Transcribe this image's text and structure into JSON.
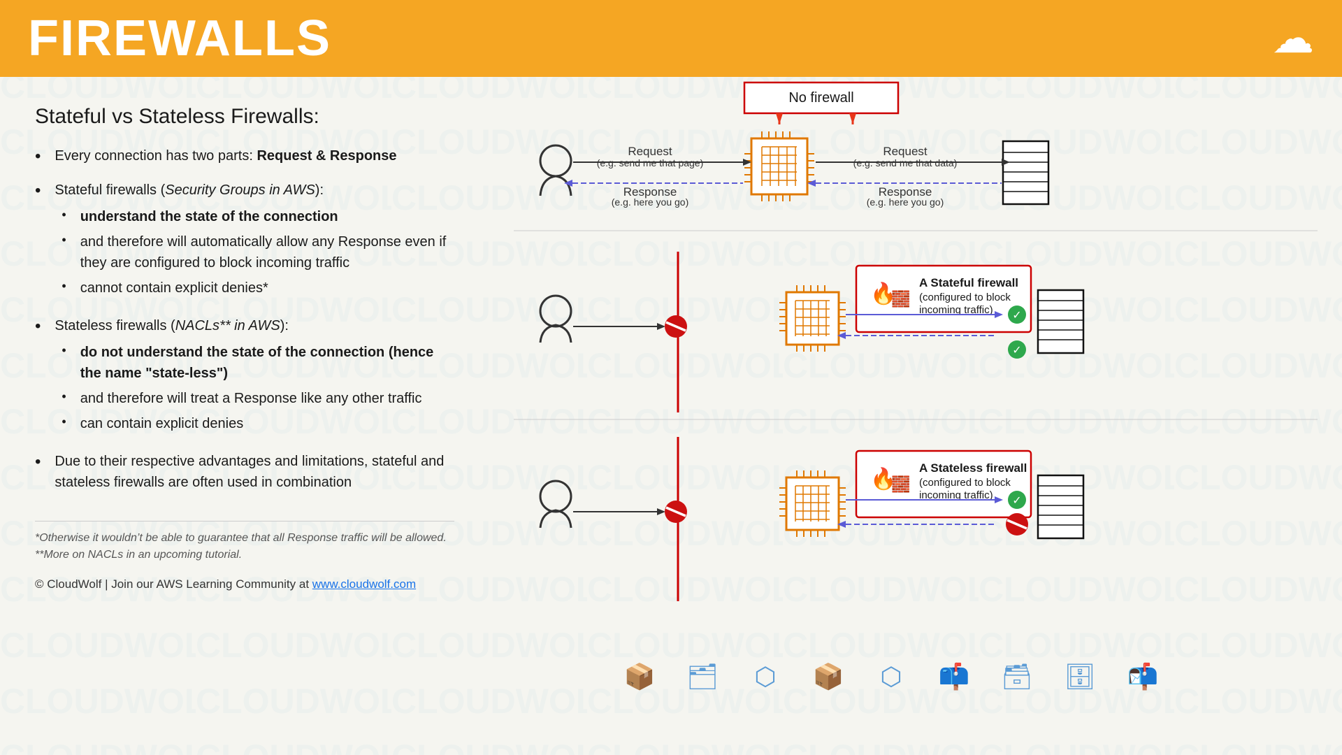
{
  "header": {
    "title": "FIREWALLS",
    "cloud_icon": "☁"
  },
  "watermark_text": "CLOUDWOLF",
  "left": {
    "heading": "Stateful vs Stateless Firewalls:",
    "bullets": [
      {
        "text_plain": "Every connection has two parts: ",
        "text_bold": "Request & Response"
      },
      {
        "text_italic": "Security Groups in AWS",
        "prefix": "Stateful firewalls (",
        "suffix": "):",
        "sub": [
          {
            "bold": "understand the state of the connection"
          },
          {
            "plain": "and therefore will automatically allow any Response even if they are configured to block incoming traffic"
          },
          {
            "plain": "cannot contain explicit denies*"
          }
        ]
      },
      {
        "prefix": "Stateless firewalls (",
        "text_italic": "NACLs** in AWS",
        "suffix": "):",
        "sub": [
          {
            "bold": "do not understand the state of the connection (hence the name “state-less”)"
          },
          {
            "plain": "and therefore will treat a Response like any other traffic"
          },
          {
            "plain": "can contain explicit denies"
          }
        ]
      },
      {
        "plain": "Due to their respective advantages and limitations, stateful and stateless firewalls are often used in combination"
      }
    ],
    "footnote1": "*Otherwise it wouldn’t be able to guarantee that all Response traffic will be allowed.",
    "footnote2": "**More on NACLs in an upcoming tutorial.",
    "footer": "© CloudWolf  |  Join our AWS Learning Community at ",
    "footer_link_text": "www.cloudwolf.com",
    "footer_link_url": "https://www.cloudwolf.com"
  },
  "right": {
    "no_firewall_label": "No firewall",
    "diagram_top": {
      "left_request": "Request\n(e.g. send me that page)",
      "left_response": "Response\n(e.g. here you go)",
      "right_request": "Request\n(e.g. send me that data)",
      "right_response": "Response\n(e.g. here you go)"
    },
    "diagram_stateful": {
      "label": "A Stateful firewall",
      "sublabel": "(configured to block\nincoming traffic)"
    },
    "diagram_stateless": {
      "label": "A Stateless firewall",
      "sublabel": "(configured to block\nincoming traffic)"
    }
  }
}
